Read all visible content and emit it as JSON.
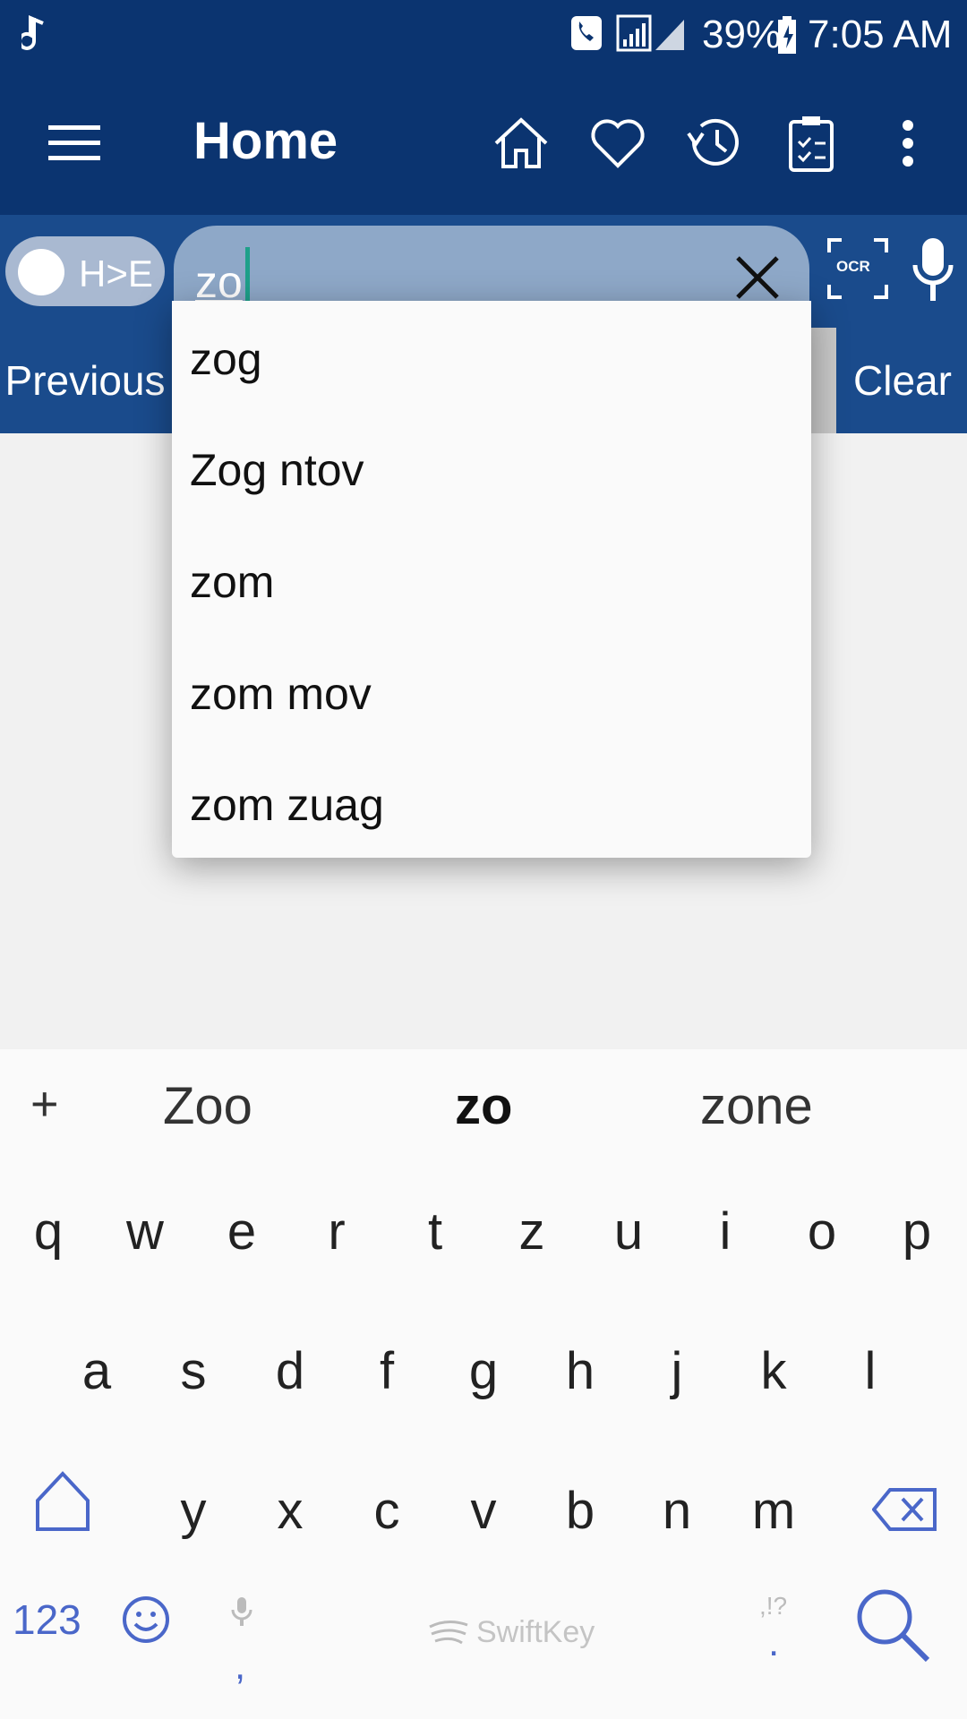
{
  "status_bar": {
    "battery": "39%",
    "time": "7:05 AM"
  },
  "toolbar": {
    "title": "Home",
    "icons": [
      "menu-icon",
      "home-icon",
      "heart-icon",
      "history-icon",
      "clipboard-icon",
      "more-icon"
    ]
  },
  "search": {
    "toggle_label": "H>E",
    "query": "zo",
    "ocr_label": "OCR"
  },
  "nav": {
    "previous": "Previous",
    "clear": "Clear"
  },
  "suggestions": [
    "zog",
    "Zog ntov",
    "zom",
    "zom mov",
    "zom zuag"
  ],
  "keyboard": {
    "predictions": [
      "Zoo",
      "zo",
      "zone"
    ],
    "plus": "+",
    "row1": [
      "q",
      "w",
      "e",
      "r",
      "t",
      "z",
      "u",
      "i",
      "o",
      "p"
    ],
    "row2": [
      "a",
      "s",
      "d",
      "f",
      "g",
      "h",
      "j",
      "k",
      "l"
    ],
    "row3": [
      "y",
      "x",
      "c",
      "v",
      "b",
      "n",
      "m"
    ],
    "numbers_key": "123",
    "comma": ",",
    "period": ".",
    "punct_hint": ",!?",
    "brand": "SwiftKey"
  },
  "colors": {
    "appbar": "#0b3470",
    "search_row": "#1a4b8c",
    "keyboard_accent": "#4a67c9"
  }
}
